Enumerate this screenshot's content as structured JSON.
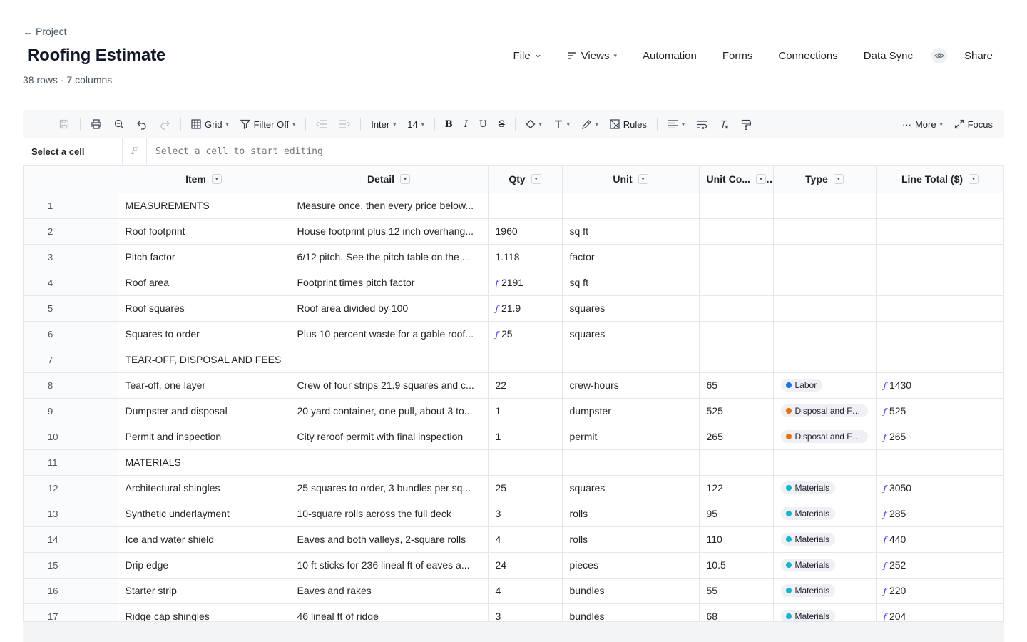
{
  "header": {
    "back_label": "Project",
    "title": "Roofing Estimate",
    "subtitle": "38 rows · 7 columns"
  },
  "nav": {
    "file": "File",
    "views": "Views",
    "automation": "Automation",
    "forms": "Forms",
    "connections": "Connections",
    "data_sync": "Data Sync",
    "share": "Share"
  },
  "toolbar": {
    "grid": "Grid",
    "filter": "Filter Off",
    "font": "Inter",
    "size": "14",
    "bold": "B",
    "italic": "I",
    "underline": "U",
    "strike": "S",
    "rules": "Rules",
    "more": "More",
    "focus": "Focus"
  },
  "formula": {
    "cell_ref": "Select a cell",
    "fx": "F",
    "placeholder": "Select a cell to start editing"
  },
  "columns": [
    "Item",
    "Detail",
    "Qty",
    "Unit",
    "Unit Co...",
    "Type",
    "Line Total ($)"
  ],
  "type_colors": {
    "Labor": "#1a73e8",
    "Disposal and Fees": "#e8710a",
    "Materials": "#12b5cb"
  },
  "rows": [
    {
      "n": "1",
      "item": "MEASUREMENTS",
      "detail": "Measure once, then every price below...",
      "qty": "",
      "qty_f": false,
      "unit": "",
      "cost": "",
      "type": "",
      "total": ""
    },
    {
      "n": "2",
      "item": "Roof footprint",
      "detail": "House footprint plus 12 inch overhang...",
      "qty": "1960",
      "qty_f": false,
      "unit": "sq ft",
      "cost": "",
      "type": "",
      "total": ""
    },
    {
      "n": "3",
      "item": "Pitch factor",
      "detail": "6/12 pitch. See the pitch table on the ...",
      "qty": "1.118",
      "qty_f": false,
      "unit": "factor",
      "cost": "",
      "type": "",
      "total": ""
    },
    {
      "n": "4",
      "item": "Roof area",
      "detail": "Footprint times pitch factor",
      "qty": "2191",
      "qty_f": true,
      "unit": "sq ft",
      "cost": "",
      "type": "",
      "total": ""
    },
    {
      "n": "5",
      "item": "Roof squares",
      "detail": "Roof area divided by 100",
      "qty": "21.9",
      "qty_f": true,
      "unit": "squares",
      "cost": "",
      "type": "",
      "total": ""
    },
    {
      "n": "6",
      "item": "Squares to order",
      "detail": "Plus 10 percent waste for a gable roof...",
      "qty": "25",
      "qty_f": true,
      "unit": "squares",
      "cost": "",
      "type": "",
      "total": ""
    },
    {
      "n": "7",
      "item": "TEAR-OFF, DISPOSAL AND FEES",
      "detail": "",
      "qty": "",
      "qty_f": false,
      "unit": "",
      "cost": "",
      "type": "",
      "total": ""
    },
    {
      "n": "8",
      "item": "Tear-off, one layer",
      "detail": "Crew of four strips 21.9 squares and c...",
      "qty": "22",
      "qty_f": false,
      "unit": "crew-hours",
      "cost": "65",
      "type": "Labor",
      "total": "1430"
    },
    {
      "n": "9",
      "item": "Dumpster and disposal",
      "detail": "20 yard container, one pull, about 3 to...",
      "qty": "1",
      "qty_f": false,
      "unit": "dumpster",
      "cost": "525",
      "type": "Disposal and Fees",
      "total": "525"
    },
    {
      "n": "10",
      "item": "Permit and inspection",
      "detail": "City reroof permit with final inspection",
      "qty": "1",
      "qty_f": false,
      "unit": "permit",
      "cost": "265",
      "type": "Disposal and Fees",
      "total": "265"
    },
    {
      "n": "11",
      "item": "MATERIALS",
      "detail": "",
      "qty": "",
      "qty_f": false,
      "unit": "",
      "cost": "",
      "type": "",
      "total": ""
    },
    {
      "n": "12",
      "item": "Architectural shingles",
      "detail": "25 squares to order, 3 bundles per sq...",
      "qty": "25",
      "qty_f": false,
      "unit": "squares",
      "cost": "122",
      "type": "Materials",
      "total": "3050"
    },
    {
      "n": "13",
      "item": "Synthetic underlayment",
      "detail": "10-square rolls across the full deck",
      "qty": "3",
      "qty_f": false,
      "unit": "rolls",
      "cost": "95",
      "type": "Materials",
      "total": "285"
    },
    {
      "n": "14",
      "item": "Ice and water shield",
      "detail": "Eaves and both valleys, 2-square rolls",
      "qty": "4",
      "qty_f": false,
      "unit": "rolls",
      "cost": "110",
      "type": "Materials",
      "total": "440"
    },
    {
      "n": "15",
      "item": "Drip edge",
      "detail": "10 ft sticks for 236 lineal ft of eaves a...",
      "qty": "24",
      "qty_f": false,
      "unit": "pieces",
      "cost": "10.5",
      "type": "Materials",
      "total": "252"
    },
    {
      "n": "16",
      "item": "Starter strip",
      "detail": "Eaves and rakes",
      "qty": "4",
      "qty_f": false,
      "unit": "bundles",
      "cost": "55",
      "type": "Materials",
      "total": "220"
    },
    {
      "n": "17",
      "item": "Ridge cap shingles",
      "detail": "46 lineal ft of ridge",
      "qty": "3",
      "qty_f": false,
      "unit": "bundles",
      "cost": "68",
      "type": "Materials",
      "total": "204"
    }
  ]
}
